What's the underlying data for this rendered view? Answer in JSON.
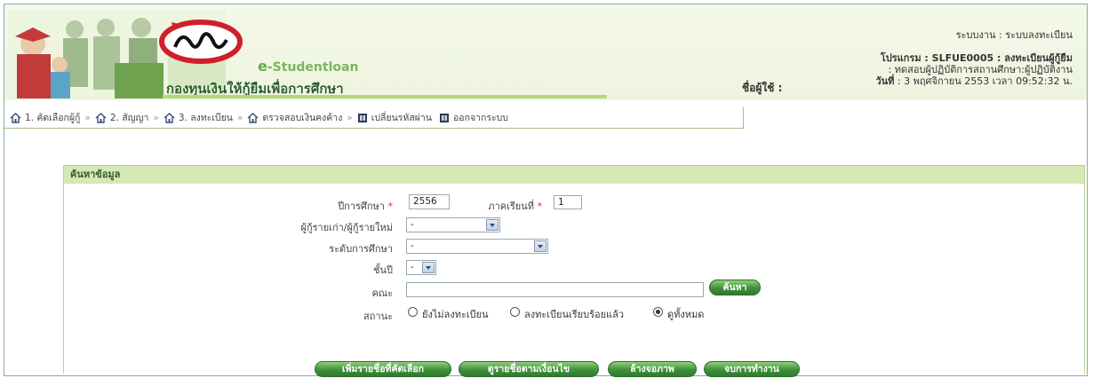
{
  "header": {
    "brand_small": "-Studentloan",
    "brand_e": "e",
    "fund_name": "กองทุนเงินให้กู้ยืมเพื่อการศึกษา",
    "username_label": "ชื่อผู้ใช้ :",
    "system": "ระบบงาน : ระบบลงทะเบียน",
    "program": "โปรแกรม : SLFUE0005 : ลงทะเบียนผู้กู้ยืม",
    "program_desc": ": ทดสอบผู้ปฏิบัติการสถานศึกษา:ผู้ปฏิบัติงาน",
    "date_label": "วันที่",
    "date": ": 3 พฤศจิกายน 2553 เวลา 09:52:32 น."
  },
  "nav": {
    "items": [
      {
        "label": "1. คัดเลือกผู้กู้",
        "icon": "home-icon"
      },
      {
        "label": "2. สัญญา",
        "icon": "home-icon"
      },
      {
        "label": "3. ลงทะเบียน",
        "icon": "home-icon"
      },
      {
        "label": "ตรวจสอบเงินคงค้าง",
        "icon": "home-icon"
      },
      {
        "label": "เปลี่ยนรหัสผ่าน",
        "icon": "exit-icon"
      },
      {
        "label": "ออกจากระบบ",
        "icon": "exit-icon"
      }
    ],
    "separator": "»"
  },
  "search": {
    "title": "ค้นหาข้อมูล",
    "year_label": "ปีการศึกษา",
    "year_value": "2556",
    "term_label": "ภาคเรียนที่",
    "term_value": "1",
    "borrower_type_label": "ผู้กู้รายเก่า/ผู้กู้รายใหม่",
    "borrower_type_value": "-",
    "edu_level_label": "ระดับการศึกษา",
    "edu_level_value": "-",
    "grade_label": "ชั้นปี",
    "grade_value": "-",
    "faculty_label": "คณะ",
    "faculty_value": "",
    "search_button": "ค้นหา",
    "status_label": "สถานะ",
    "status_options": [
      "ยังไม่ลงทะเบียน",
      "ลงทะเบียนเรียบร้อยแล้ว",
      "ดูทั้งหมด"
    ],
    "status_selected": 2,
    "required_mark": "*"
  },
  "actions": {
    "add_selected": "เพิ่มรายชื่อที่คัดเลือก",
    "view_loan_pending": "ดูรายชื่อตามเงื่อนไข",
    "clear_screen": "ล้างจอภาพ",
    "finish": "จบการทำงาน"
  },
  "colors": {
    "panel_header": "#d6e8b4",
    "button_green": "#3f8f3a",
    "required": "#ee2233"
  }
}
